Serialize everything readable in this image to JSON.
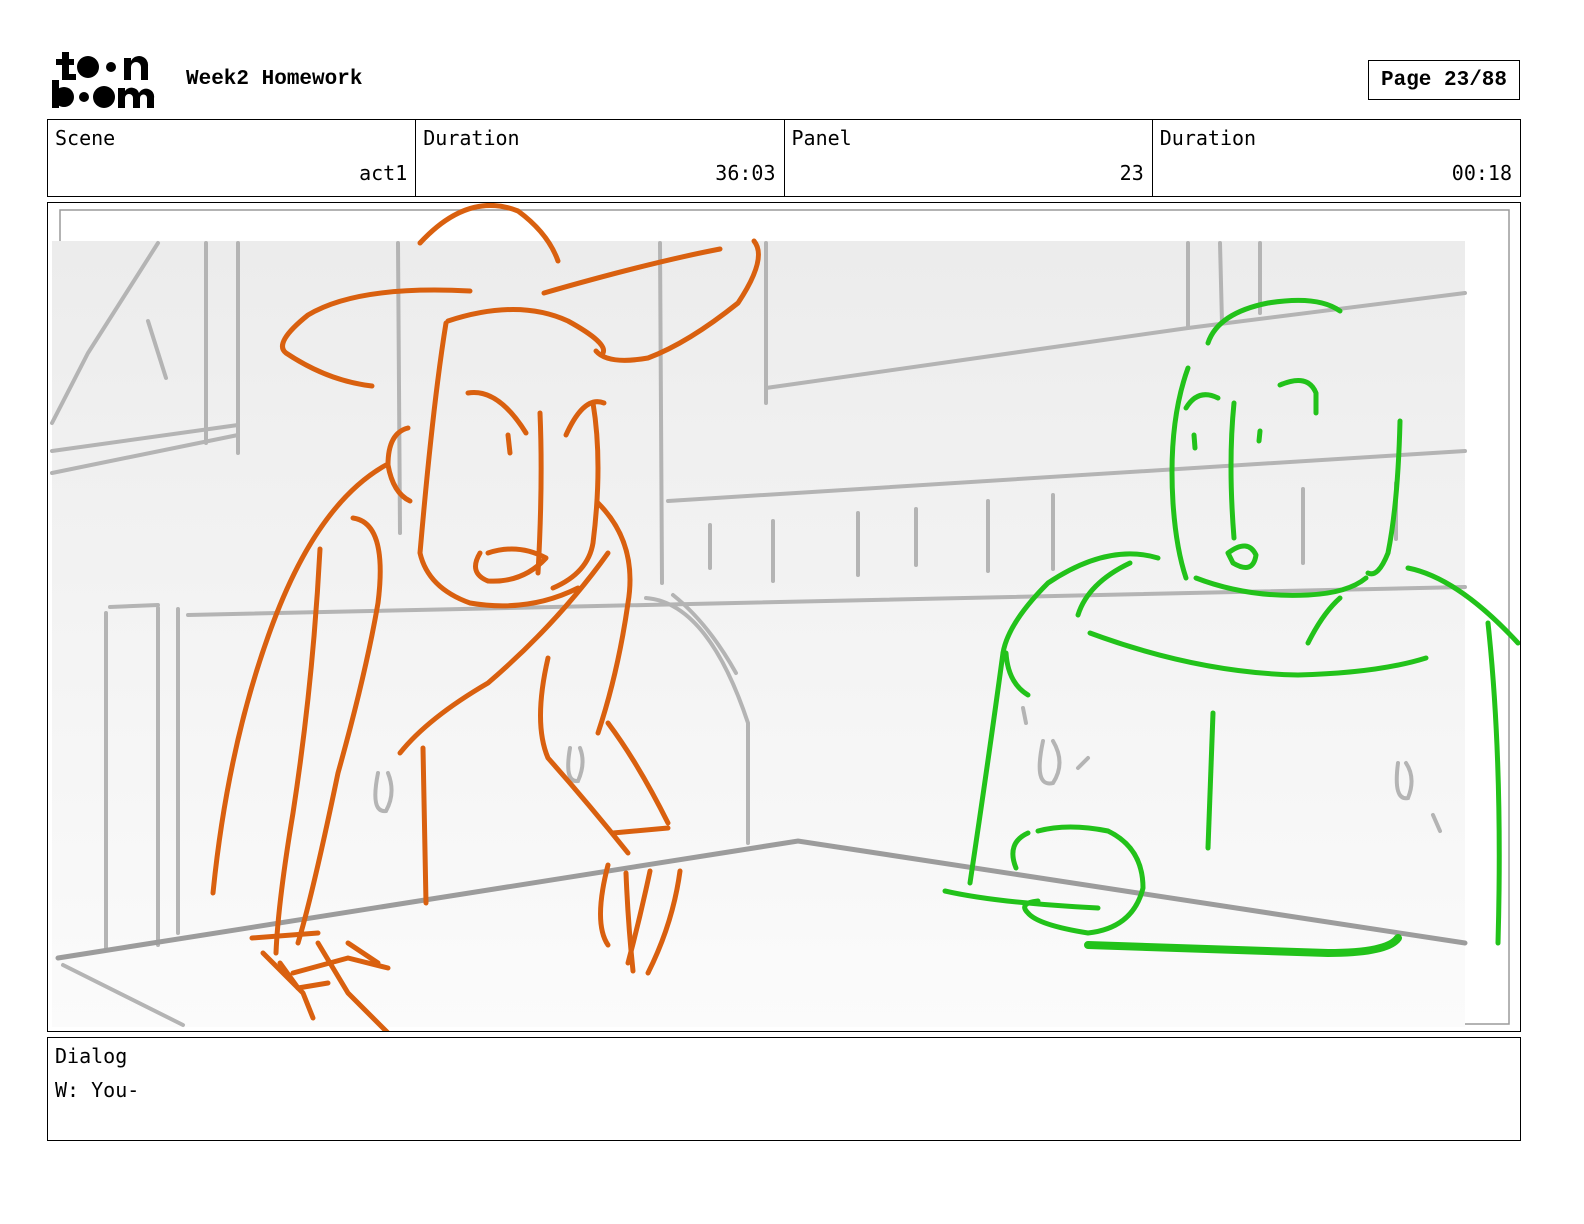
{
  "header": {
    "logo_alt": "toon boom",
    "title": "Week2 Homework",
    "page_label": "Page 23/88"
  },
  "info": {
    "scene_label": "Scene",
    "scene_value": "act1",
    "scene_duration_label": "Duration",
    "scene_duration_value": "36:03",
    "panel_label": "Panel",
    "panel_value": "23",
    "panel_duration_label": "Duration",
    "panel_duration_value": "00:18"
  },
  "dialog": {
    "label": "Dialog",
    "text": "W: You-"
  },
  "colors": {
    "character_left": "#d9600f",
    "character_right": "#22c21a",
    "background_sketch": "#a8a8a8"
  }
}
